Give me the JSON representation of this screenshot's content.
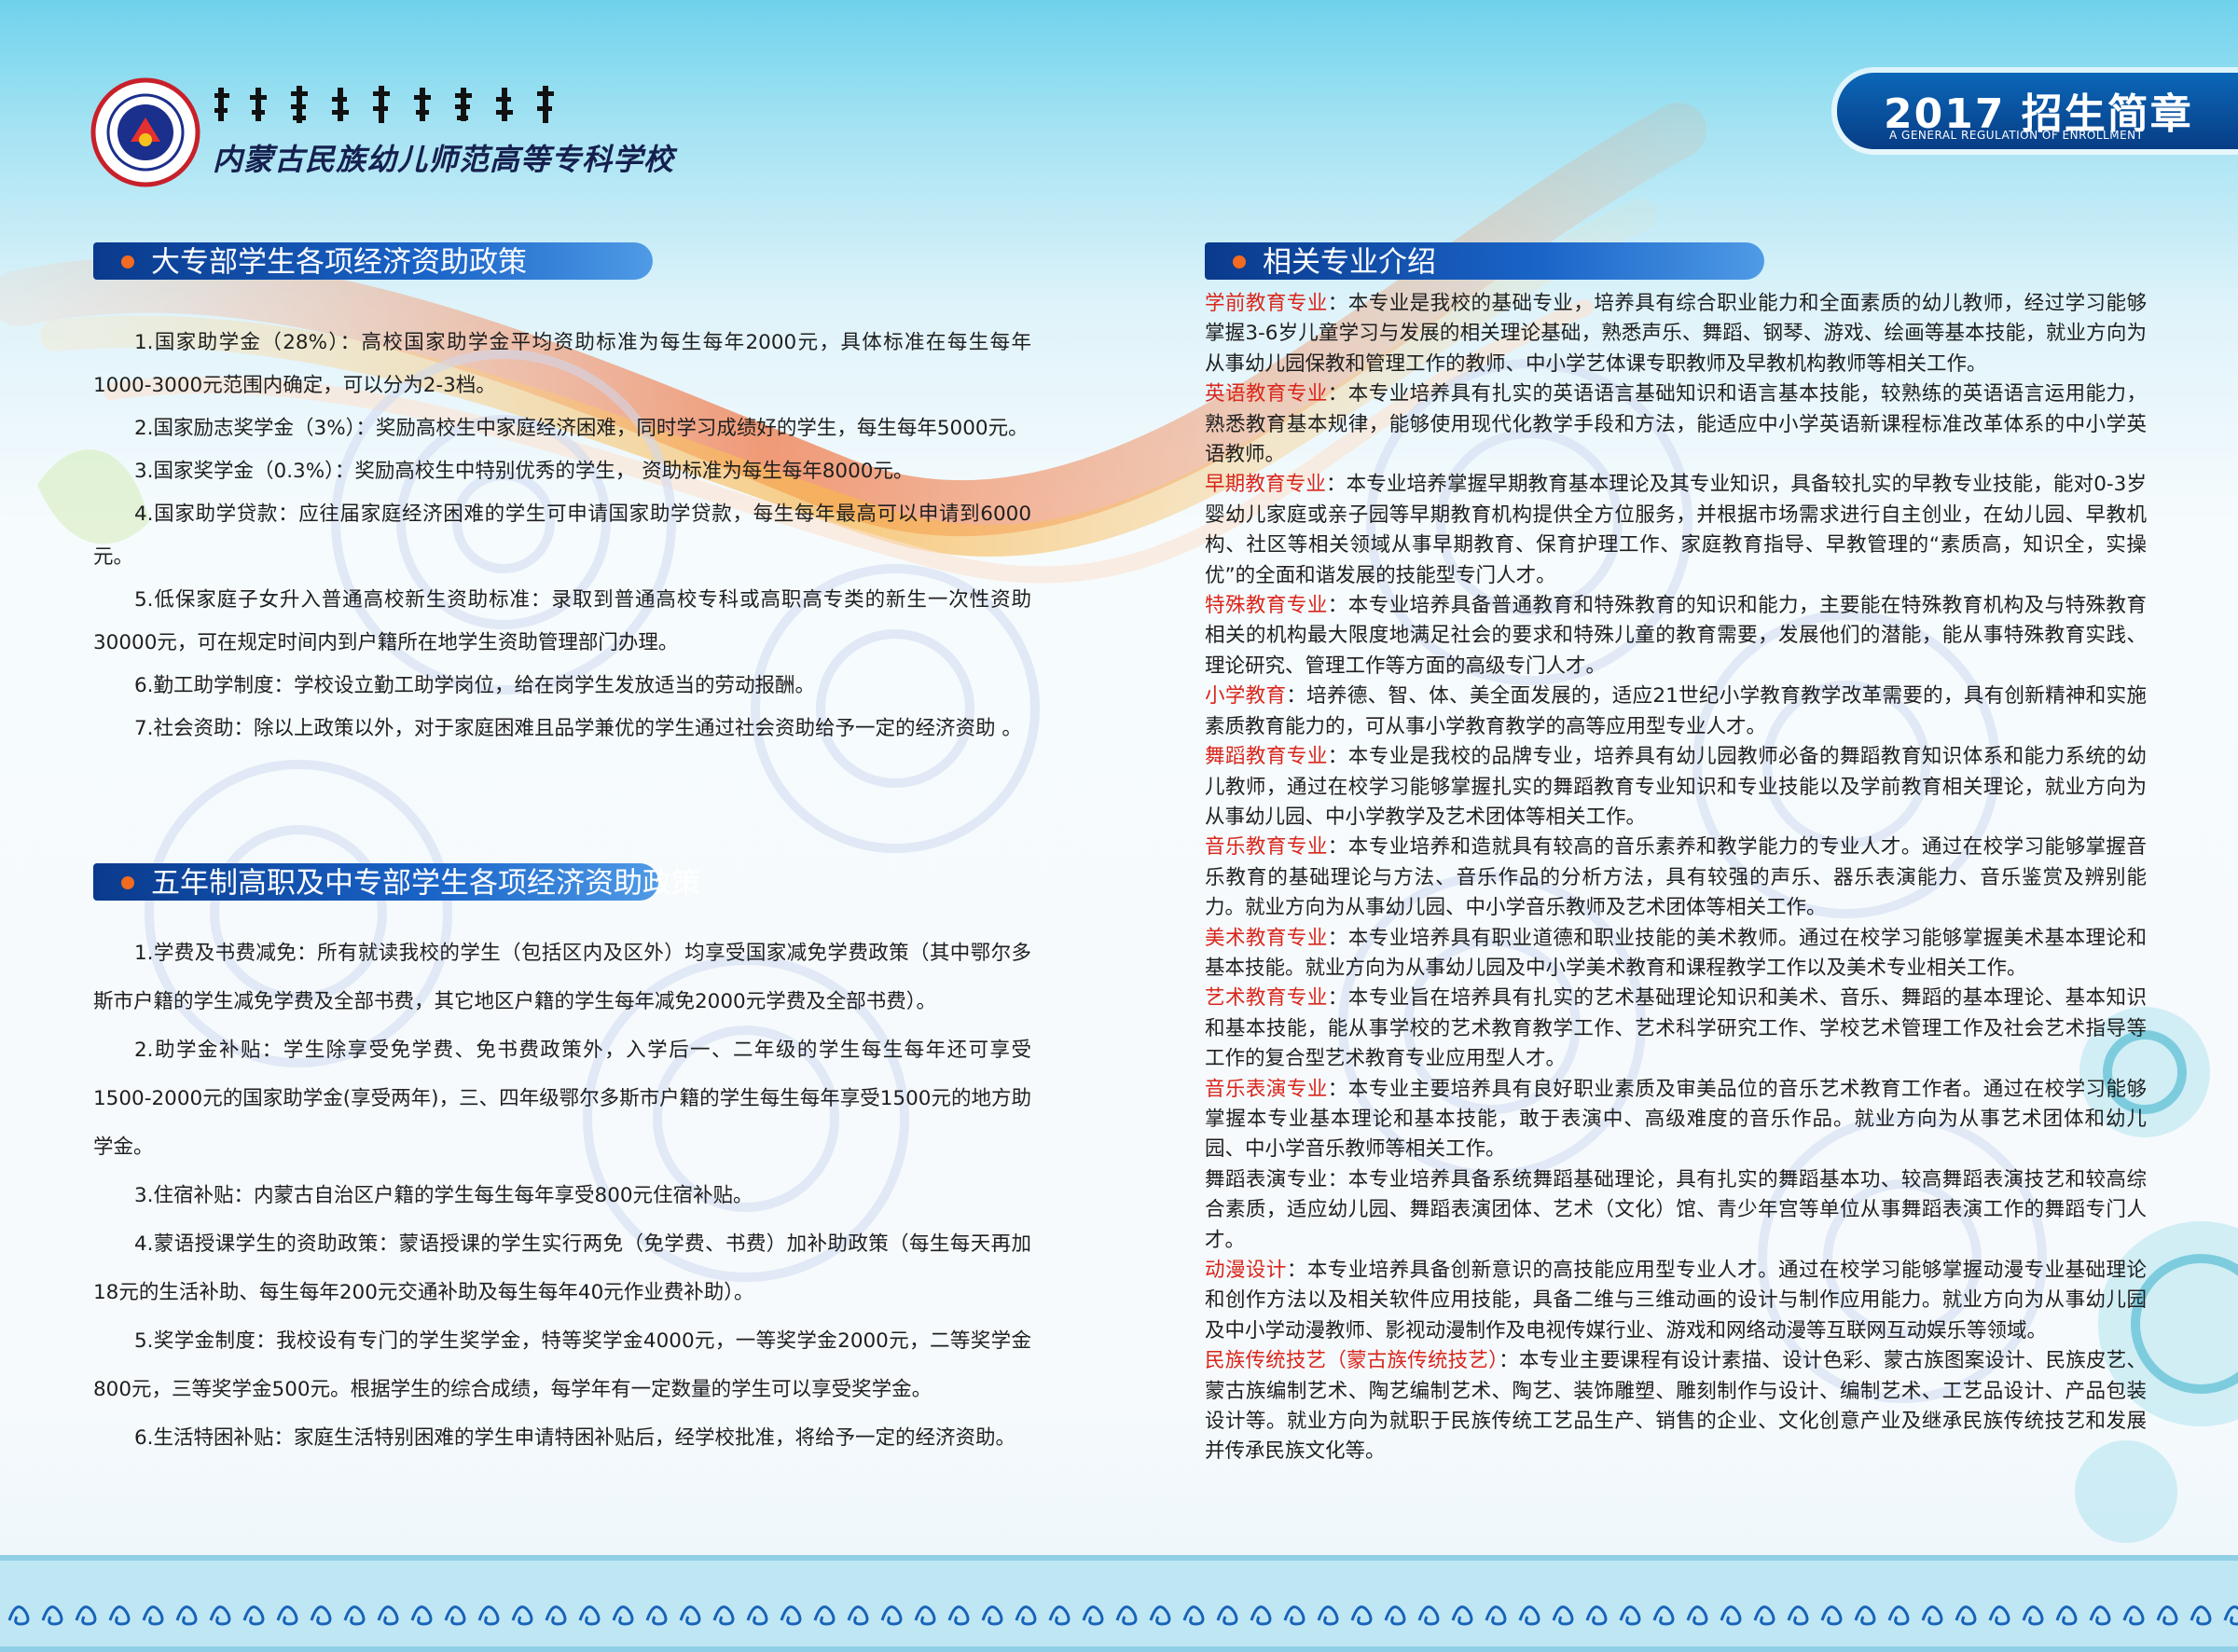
{
  "header": {
    "school_name_cn": "内蒙古民族幼儿师范高等专科学校",
    "school_name_mongolian": "ᠦᠪᠦᠷ ᠮᠣᠩᠭᠣᠯ ᠤᠨ ᠦᠨᠳᠦᠰᠦᠲᠡᠨ ᠦ ᠬᠡᠦᠬᠡᠳ ᠦᠨ ᠪᠠᠭᠰᠢ ᠶᠢᠨ ᠳᠡᠭᠡᠳᠦ ᠮᠡᠷᠭᠡᠵᠢᠯ ᠦᠨ ᠰᠤᠷᠭᠠᠭᠤᠯᠢ",
    "logo_icon": "school-emblem-icon",
    "brand_title": "2017 招生简章",
    "brand_subtitle": "A GENERAL REGULATION OF ENROLLMENT"
  },
  "colors": {
    "section_blue": "#1a64c8",
    "section_bullet": "#f26b20",
    "major_red": "#d9261c",
    "brand_blue": "#0b67b8"
  },
  "sections": {
    "college_aid": {
      "title": "大专部学生各项经济资助政策",
      "items": [
        "1.国家助学金（28%）：高校国家助学金平均资助标准为每生每年2000元，具体标准在每生每年1000-3000元范围内确定，可以分为2-3档。",
        "2.国家励志奖学金（3%）：奖励高校生中家庭经济困难，同时学习成绩好的学生，每生每年5000元。",
        "3.国家奖学金（0.3%）：奖励高校生中特别优秀的学生， 资助标准为每生每年8000元。",
        "4.国家助学贷款：应往届家庭经济困难的学生可申请国家助学贷款，每生每年最高可以申请到6000元。",
        "5.低保家庭子女升入普通高校新生资助标准：录取到普通高校专科或高职高专类的新生一次性资助30000元，可在规定时间内到户籍所在地学生资助管理部门办理。",
        "6.勤工助学制度：学校设立勤工助学岗位，给在岗学生发放适当的劳动报酬。",
        "7.社会资助：除以上政策以外，对于家庭困难且品学兼优的学生通过社会资助给予一定的经济资助 。"
      ]
    },
    "secondary_aid": {
      "title": "五年制高职及中专部学生各项经济资助政策",
      "items": [
        "1.学费及书费减免：所有就读我校的学生（包括区内及区外）均享受国家减免学费政策（其中鄂尔多斯市户籍的学生减免学费及全部书费，其它地区户籍的学生每年减免2000元学费及全部书费）。",
        "2.助学金补贴：学生除享受免学费、免书费政策外，入学后一、二年级的学生每生每年还可享受1500-2000元的国家助学金(享受两年)，三、四年级鄂尔多斯市户籍的学生每生每年享受1500元的地方助学金。",
        "3.住宿补贴：内蒙古自治区户籍的学生每生每年享受800元住宿补贴。",
        "4.蒙语授课学生的资助政策：蒙语授课的学生实行两免（免学费、书费）加补助政策（每生每天再加18元的生活补助、每生每年200元交通补助及每生每年40元作业费补助）。",
        "5.奖学金制度：我校设有专门的学生奖学金，特等奖学金4000元，一等奖学金2000元，二等奖学金800元，三等奖学金500元。根据学生的综合成绩，每学年有一定数量的学生可以享受奖学金。",
        "6.生活特困补贴：家庭生活特别困难的学生申请特困补贴后，经学校批准，将给予一定的经济资助。"
      ]
    },
    "majors": {
      "title": "相关专业介绍",
      "items": [
        {
          "name": "学前教育专业",
          "sub": "",
          "highlight": true,
          "desc": "：本专业是我校的基础专业，培养具有综合职业能力和全面素质的幼儿教师，经过学习能够掌握3-6岁儿童学习与发展的相关理论基础，熟悉声乐、舞蹈、钢琴、游戏、绘画等基本技能，就业方向为从事幼儿园保教和管理工作的教师、中小学艺体课专职教师及早教机构教师等相关工作。"
        },
        {
          "name": "英语教育专业",
          "sub": "",
          "highlight": true,
          "desc": "：本专业培养具有扎实的英语语言基础知识和语言基本技能，较熟练的英语语言运用能力，熟悉教育基本规律，能够使用现代化教学手段和方法，能适应中小学英语新课程标准改革体系的中小学英语教师。"
        },
        {
          "name": "早期教育专业",
          "sub": "",
          "highlight": true,
          "desc": "：本专业培养掌握早期教育基本理论及其专业知识，具备较扎实的早教专业技能，能对0-3岁婴幼儿家庭或亲子园等早期教育机构提供全方位服务，并根据市场需求进行自主创业，在幼儿园、早教机构、社区等相关领域从事早期教育、保育护理工作、家庭教育指导、早教管理的“素质高，知识全，实操优”的全面和谐发展的技能型专门人才。"
        },
        {
          "name": "特殊教育专业",
          "sub": "",
          "highlight": true,
          "desc": "：本专业培养具备普通教育和特殊教育的知识和能力，主要能在特殊教育机构及与特殊教育相关的机构最大限度地满足社会的要求和特殊儿童的教育需要，发展他们的潜能，能从事特殊教育实践、理论研究、管理工作等方面的高级专门人才。"
        },
        {
          "name": "小学教育",
          "sub": "",
          "highlight": true,
          "desc": "：培养德、智、体、美全面发展的，适应21世纪小学教育教学改革需要的，具有创新精神和实施素质教育能力的，可从事小学教育教学的高等应用型专业人才。"
        },
        {
          "name": "舞蹈教育专业",
          "sub": "",
          "highlight": true,
          "desc": "：本专业是我校的品牌专业，培养具有幼儿园教师必备的舞蹈教育知识体系和能力系统的幼儿教师，通过在校学习能够掌握扎实的舞蹈教育专业知识和专业技能以及学前教育相关理论，就业方向为从事幼儿园、中小学教学及艺术团体等相关工作。"
        },
        {
          "name": "音乐教育专业",
          "sub": "",
          "highlight": true,
          "desc": "：本专业培养和造就具有较高的音乐素养和教学能力的专业人才。通过在校学习能够掌握音乐教育的基础理论与方法、音乐作品的分析方法，具有较强的声乐、器乐表演能力、音乐鉴赏及辨别能力。就业方向为从事幼儿园、中小学音乐教师及艺术团体等相关工作。"
        },
        {
          "name": "美术教育专业",
          "sub": "",
          "highlight": true,
          "desc": "：本专业培养具有职业道德和职业技能的美术教师。通过在校学习能够掌握美术基本理论和基本技能。就业方向为从事幼儿园及中小学美术教育和课程教学工作以及美术专业相关工作。"
        },
        {
          "name": "艺术教育专业",
          "sub": "",
          "highlight": true,
          "desc": "：本专业旨在培养具有扎实的艺术基础理论知识和美术、音乐、舞蹈的基本理论、基本知识和基本技能，能从事学校的艺术教育教学工作、艺术科学研究工作、学校艺术管理工作及社会艺术指导等工作的复合型艺术教育专业应用型人才。"
        },
        {
          "name": "音乐表演专业",
          "sub": "",
          "highlight": true,
          "desc": "：本专业主要培养具有良好职业素质及审美品位的音乐艺术教育工作者。通过在校学习能够掌握本专业基本理论和基本技能，敢于表演中、高级难度的音乐作品。就业方向为从事艺术团体和幼儿园、中小学音乐教师等相关工作。"
        },
        {
          "name": "舞蹈表演专业",
          "sub": "",
          "highlight": false,
          "desc": "：本专业培养具备系统舞蹈基础理论，具有扎实的舞蹈基本功、较高舞蹈表演技艺和较高综合素质，适应幼儿园、舞蹈表演团体、艺术（文化）馆、青少年宫等单位从事舞蹈表演工作的舞蹈专门人才。"
        },
        {
          "name": "动漫设计",
          "sub": "",
          "highlight": true,
          "desc": "：本专业培养具备创新意识的高技能应用型专业人才。通过在校学习能够掌握动漫专业基础理论和创作方法以及相关软件应用技能，具备二维与三维动画的设计与制作应用能力。就业方向为从事幼儿园及中小学动漫教师、影视动漫制作及电视传媒行业、游戏和网络动漫等互联网互动娱乐等领域。"
        },
        {
          "name": "民族传统技艺",
          "sub": "（蒙古族传统技艺）",
          "highlight": true,
          "desc": "：本专业主要课程有设计素描、设计色彩、蒙古族图案设计、民族皮艺、蒙古族编制艺术、陶艺编制艺术、陶艺、装饰雕塑、雕刻制作与设计、编制艺术、工艺品设计、产品包装设计等。就业方向为就职于民族传统工艺品生产、销售的企业、文化创意产业及继承民族传统技艺和发展并传承民族文化等。"
        }
      ]
    }
  }
}
